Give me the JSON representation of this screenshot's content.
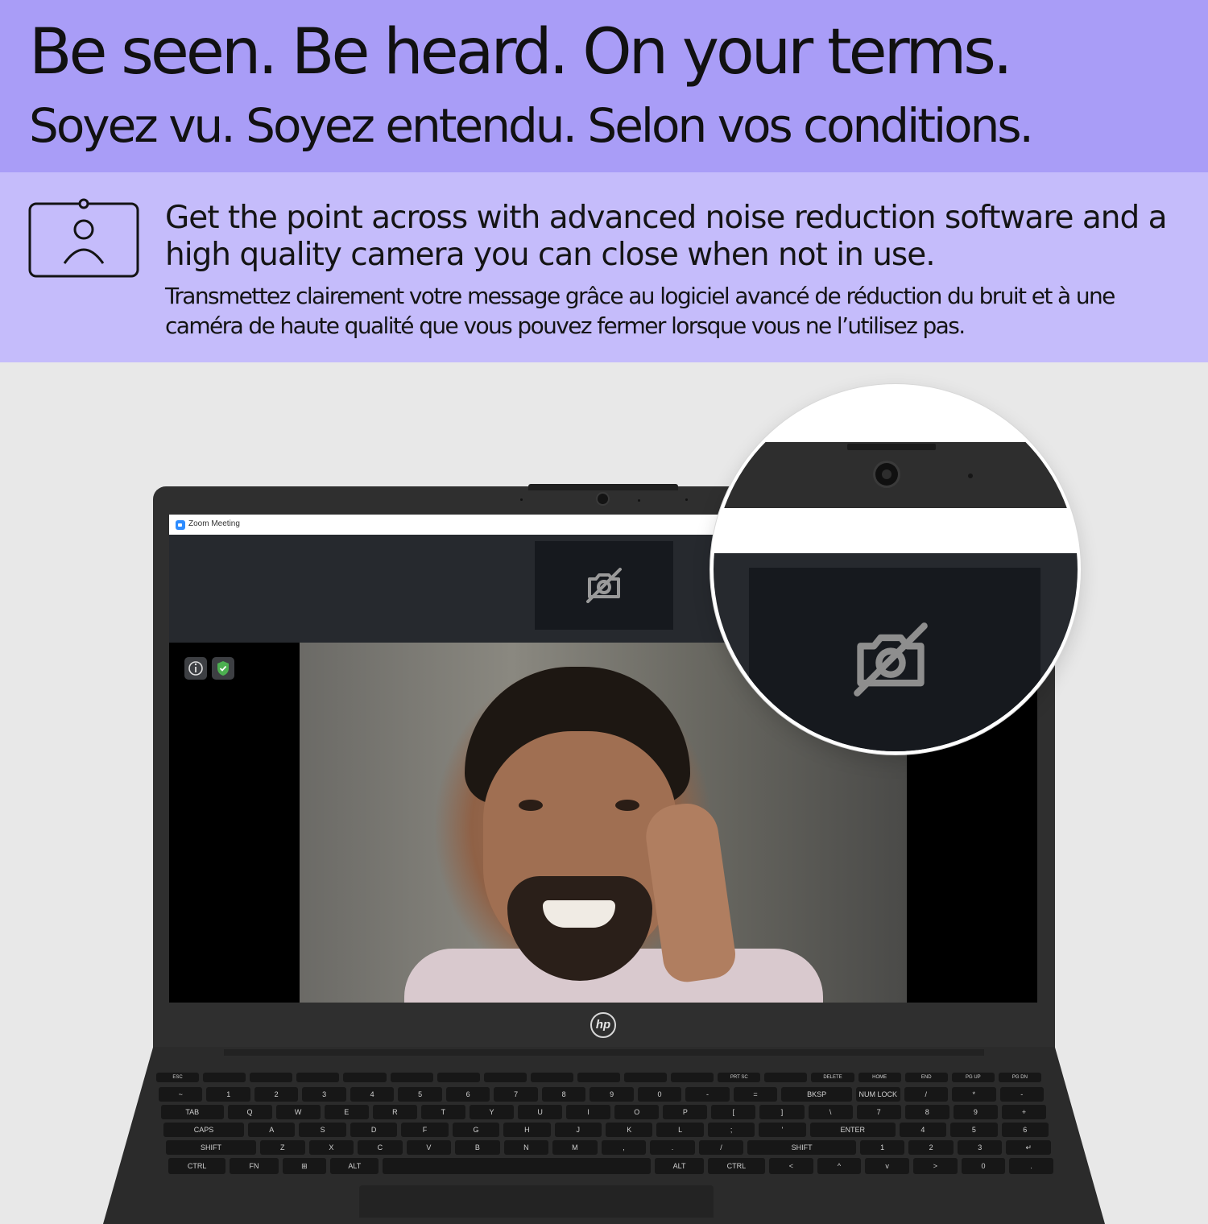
{
  "headline": "Be seen. Be heard. On your terms.",
  "subheadline": "Soyez vu. Soyez entendu. Selon vos conditions.",
  "feature": {
    "icon": "camera-person-icon",
    "text_en": "Get the point across with advanced noise reduction software and a high quality camera you can close when not in use.",
    "text_fr": "Transmettez clairement votre message grâce au logiciel avancé de réduction du bruit et à une caméra de haute qualité que vous pouvez fermer lorsque vous ne l’utilisez pas."
  },
  "screen": {
    "app_title": "Zoom Meeting",
    "camera_off_icon": "camera-off-icon",
    "badges": [
      "info-icon",
      "shield-check-icon"
    ]
  },
  "laptop": {
    "brand": "hp"
  },
  "keyboard": {
    "row0": [
      "ESC",
      "",
      "",
      "",
      "",
      "",
      "",
      "",
      "",
      "",
      "",
      "",
      "PRT SC",
      "",
      "DELETE",
      "HOME",
      "END",
      "PG UP",
      "PG DN"
    ],
    "row1": [
      "~",
      "1",
      "2",
      "3",
      "4",
      "5",
      "6",
      "7",
      "8",
      "9",
      "0",
      "-",
      "=",
      "BKSP",
      "NUM LOCK",
      "/",
      "*",
      "-"
    ],
    "row2": [
      "TAB",
      "Q",
      "W",
      "E",
      "R",
      "T",
      "Y",
      "U",
      "I",
      "O",
      "P",
      "[",
      "]",
      "\\",
      "7",
      "8",
      "9",
      "+"
    ],
    "row3": [
      "CAPS",
      "A",
      "S",
      "D",
      "F",
      "G",
      "H",
      "J",
      "K",
      "L",
      ";",
      "'",
      "ENTER",
      "4",
      "5",
      "6"
    ],
    "row4": [
      "SHIFT",
      "Z",
      "X",
      "C",
      "V",
      "B",
      "N",
      "M",
      ",",
      ".",
      "/",
      "SHIFT",
      "1",
      "2",
      "3",
      "↵"
    ],
    "row5": [
      "CTRL",
      "FN",
      "⊞",
      "ALT",
      "",
      "ALT",
      "CTRL",
      "<",
      "^",
      "v",
      ">",
      "0",
      "."
    ]
  },
  "colors": {
    "band_top": "#a99df7",
    "band_mid": "#c5bcfb",
    "zoom_blue": "#2d8cff",
    "shield_green": "#4caf50"
  }
}
